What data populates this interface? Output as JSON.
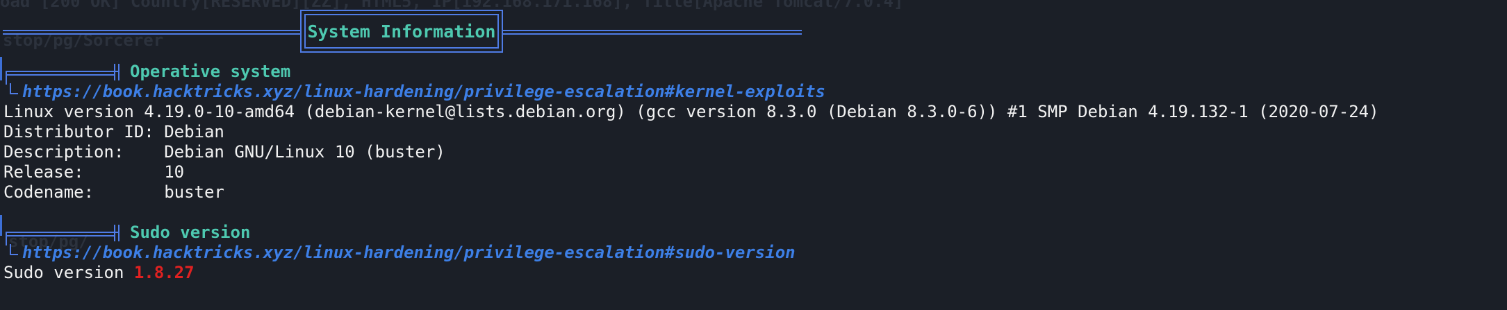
{
  "ghost": {
    "top_line": "oad [200 OK] Country[RESERVED][ZZ], HTML5, IP[192.168.171.168], Title[Apache Tomcat/7.0.4]",
    "path_line": "stop/pg/Sorcerer",
    "sudo_residue": "stop/pg/"
  },
  "banner": {
    "title": "System Information"
  },
  "sections": [
    {
      "title": "Operative system",
      "link": "https://book.hacktricks.xyz/linux-hardening/privilege-escalation#kernel-exploits",
      "lines": [
        "Linux version 4.19.0-10-amd64 (debian-kernel@lists.debian.org) (gcc version 8.3.0 (Debian 8.3.0-6)) #1 SMP Debian 4.19.132-1 (2020-07-24)",
        "Distributor ID: Debian",
        "Description:    Debian GNU/Linux 10 (buster)",
        "Release:        10",
        "Codename:       buster"
      ]
    },
    {
      "title": "Sudo version",
      "link": "https://book.hacktricks.xyz/linux-hardening/privilege-escalation#sudo-version",
      "output_prefix": "Sudo version ",
      "output_value": "1.8.27"
    }
  ],
  "colors": {
    "background": "#1b1f27",
    "frame_blue": "#4f7ce6",
    "title_teal": "#4ec9b0",
    "link_blue": "#3d7fe6",
    "version_red": "#e02121"
  }
}
